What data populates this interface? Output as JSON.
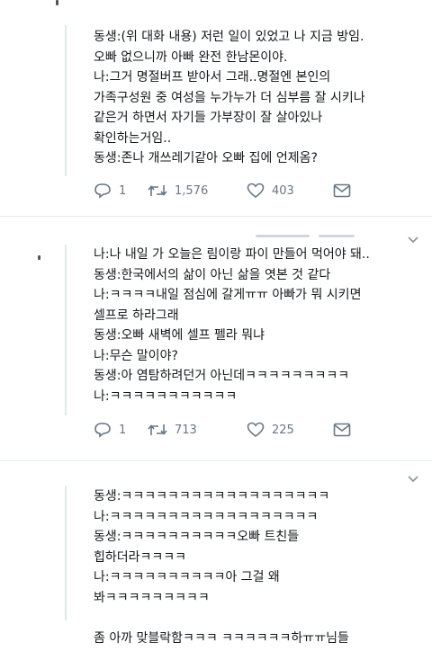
{
  "tweets": [
    {
      "lines": [
        "동생:(위 대화 내용) 저런 일이 있었고 나 지금 방임.",
        "오빠 없으니까 아빠 완전 한남몬이야.",
        "나:그거 명절버프 받아서 그래..명절엔 본인의",
        "가족구성원 중 여성을 누가누가 더 심부름 잘 시키나",
        "같은거 하면서 자기들 가부장이 잘 살아있나",
        "확인하는거임..",
        "동생:존나 개쓰레기같아 오빠 집에 언제옴?"
      ],
      "reply_icon": "reply-icon",
      "reply_count": "1",
      "retweet_icon": "retweet-icon",
      "retweet_count": "1,576",
      "like_icon": "heart-icon",
      "like_count": "403",
      "dm_icon": "envelope-icon"
    },
    {
      "lines": [
        "나:나 내일 가 오늘은 림이랑 파이 만들어 먹어야 돼..",
        "동생:한국에서의 삶이 아닌 삶을 엿본 것 같다",
        "나:ㅋㅋㅋㅋ내일 점심에 갈게ㅠㅠ 아빠가 뭐 시키면",
        "셀프로 하라그래",
        "동생:오빠 새벽에 셀프 펠라 뭐냐",
        "나:무슨 말이야?",
        "동생:아 염탐하려던거 아닌데ㅋㅋㅋㅋㅋㅋㅋㅋㅋ",
        "나:ㅋㅋㅋㅋㅋㅋㅋㅋㅋㅋㅋ"
      ],
      "reply_icon": "reply-icon",
      "reply_count": "1",
      "retweet_icon": "retweet-icon",
      "retweet_count": "713",
      "like_icon": "heart-icon",
      "like_count": "225",
      "dm_icon": "envelope-icon"
    },
    {
      "lines": [
        "동생:ㅋㅋㅋㅋㅋㅋㅋㅋㅋㅋㅋㅋㅋㅋㅋㅋㅋㅋ",
        "나:ㅋㅋㅋㅋㅋㅋㅋㅋㅋㅋㅋㅋㅋㅋㅋㅋㅋㅋ",
        "동생:ㅋㅋㅋㅋㅋㅋㅋㅋㅋㅋ오빠 트친들",
        "힙하더라ㅋㅋㅋㅋ",
        "나:ㅋㅋㅋㅋㅋㅋㅋㅋㅋㅋ아 그걸 왜",
        "봐ㅋㅋㅋㅋㅋㅋㅋㅋㅋ",
        "",
        "좀 아까 맞블락함ㅋㅋㅋ ㅋㅋㅋㅋㅋㅋ하ㅠㅠ님들"
      ]
    }
  ],
  "chevron_icon": "chevron-down-icon"
}
